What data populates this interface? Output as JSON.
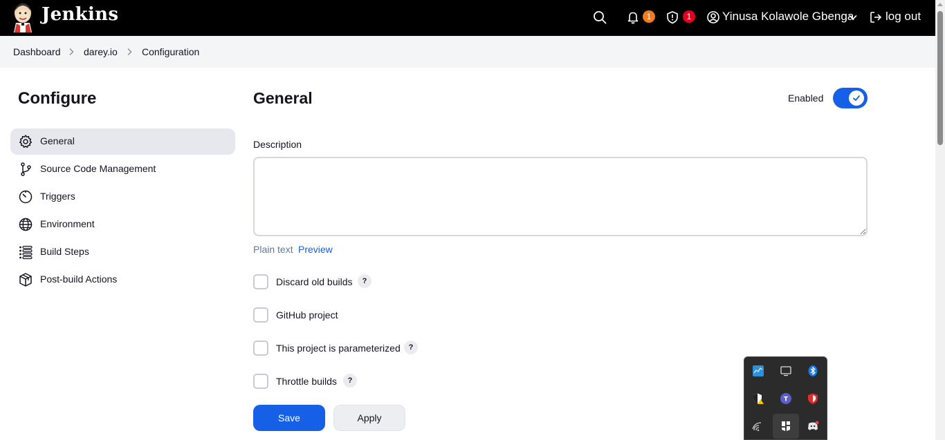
{
  "header": {
    "brand": "Jenkins",
    "notifications_count": "1",
    "security_count": "1",
    "user_name": "Yinusa Kolawole Gbenga",
    "logout_label": "log out",
    "colors": {
      "bg": "#000000",
      "notif_badge": "#f07c1e",
      "security_badge": "#e6001f"
    }
  },
  "breadcrumb": {
    "items": [
      "Dashboard",
      "darey.io",
      "Configuration"
    ]
  },
  "sidebar": {
    "title": "Configure",
    "items": [
      {
        "label": "General",
        "icon": "gear-icon",
        "active": true
      },
      {
        "label": "Source Code Management",
        "icon": "branch-icon",
        "active": false
      },
      {
        "label": "Triggers",
        "icon": "timer-icon",
        "active": false
      },
      {
        "label": "Environment",
        "icon": "globe-icon",
        "active": false
      },
      {
        "label": "Build Steps",
        "icon": "list-icon",
        "active": false
      },
      {
        "label": "Post-build Actions",
        "icon": "package-icon",
        "active": false
      }
    ]
  },
  "main": {
    "title": "General",
    "enabled_label": "Enabled",
    "enabled": true,
    "description_label": "Description",
    "description_value": "",
    "plain_text_label": "Plain text",
    "preview_label": "Preview",
    "options": [
      {
        "label": "Discard old builds",
        "checked": false,
        "help": "?"
      },
      {
        "label": "GitHub project",
        "checked": false
      },
      {
        "label": "This project is parameterized",
        "checked": false,
        "help": "?"
      },
      {
        "label": "Throttle builds",
        "checked": false,
        "help": "?"
      }
    ]
  },
  "actions": {
    "save_label": "Save",
    "apply_label": "Apply",
    "accent": "#1560e6"
  },
  "tray": {
    "icons": [
      "network-monitor-icon",
      "display-icon",
      "bluetooth-icon",
      "security-warning-icon",
      "teams-icon",
      "shield-app-icon",
      "wireless-icon",
      "app-icon",
      "discord-icon"
    ]
  }
}
